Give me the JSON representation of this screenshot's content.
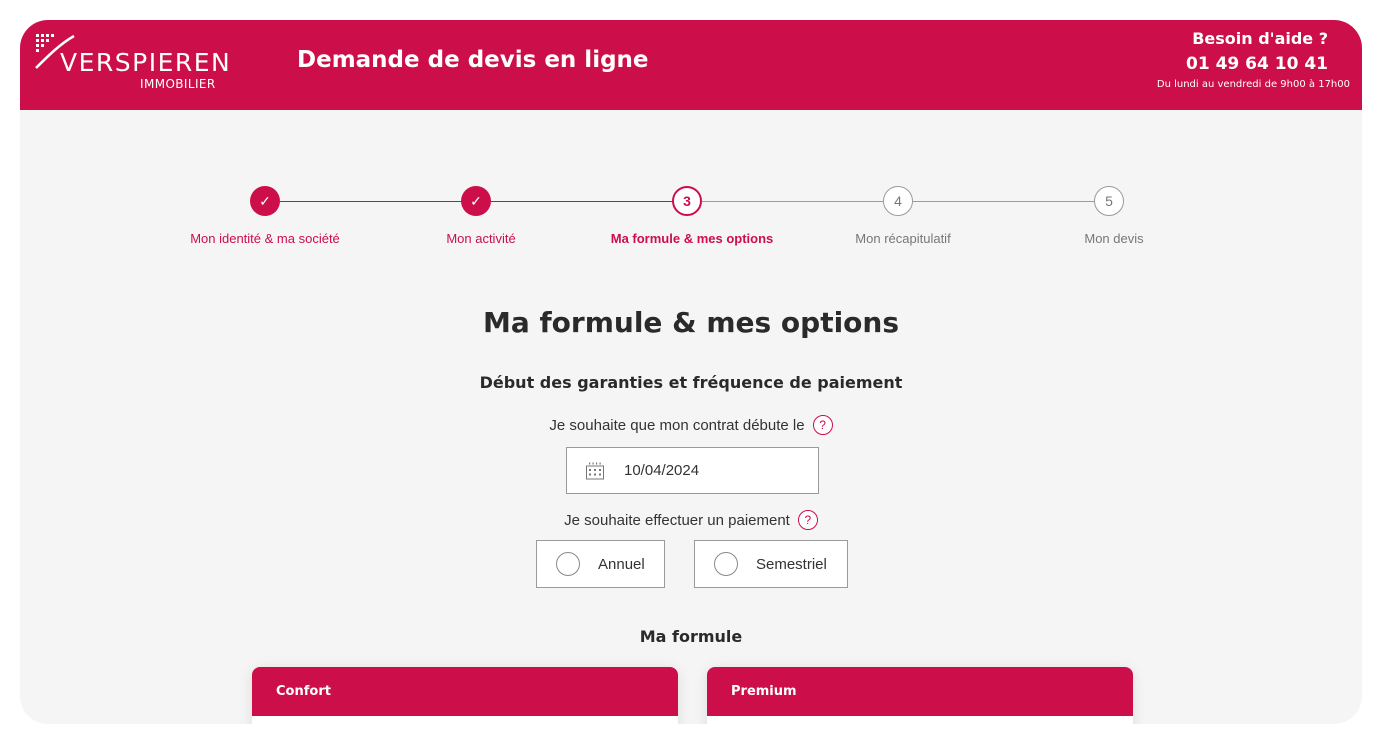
{
  "brand": {
    "name": "VERSPIEREN",
    "sub": "IMMOBILIER",
    "color": "#cc0e4a"
  },
  "header": {
    "title": "Demande de devis en ligne",
    "help_title": "Besoin d'aide ?",
    "help_phone": "01 49 64 10 41",
    "help_hours": "Du lundi au vendredi de 9h00 à 17h00"
  },
  "steps": [
    {
      "marker": "✓",
      "label": "Mon identité & ma société",
      "state": "done"
    },
    {
      "marker": "✓",
      "label": "Mon activité",
      "state": "done"
    },
    {
      "marker": "3",
      "label": "Ma formule & mes options",
      "state": "active"
    },
    {
      "marker": "4",
      "label": "Mon récapitulatif",
      "state": "todo"
    },
    {
      "marker": "5",
      "label": "Mon devis",
      "state": "todo"
    }
  ],
  "main": {
    "page_title": "Ma formule & mes options",
    "section_title": "Début des garanties et fréquence de paiement",
    "start_question": "Je souhaite que mon contrat débute le",
    "start_date": "10/04/2024",
    "payment_question": "Je souhaite effectuer un paiement",
    "payment_options": [
      "Annuel",
      "Semestriel"
    ],
    "help_glyph": "?",
    "formule_title": "Ma formule",
    "plans": [
      "Confort",
      "Premium"
    ]
  },
  "icons": {
    "logo": "verspieren-logo-icon",
    "help": "question-circle-icon",
    "calendar": "calendar-icon",
    "check": "check-icon"
  }
}
